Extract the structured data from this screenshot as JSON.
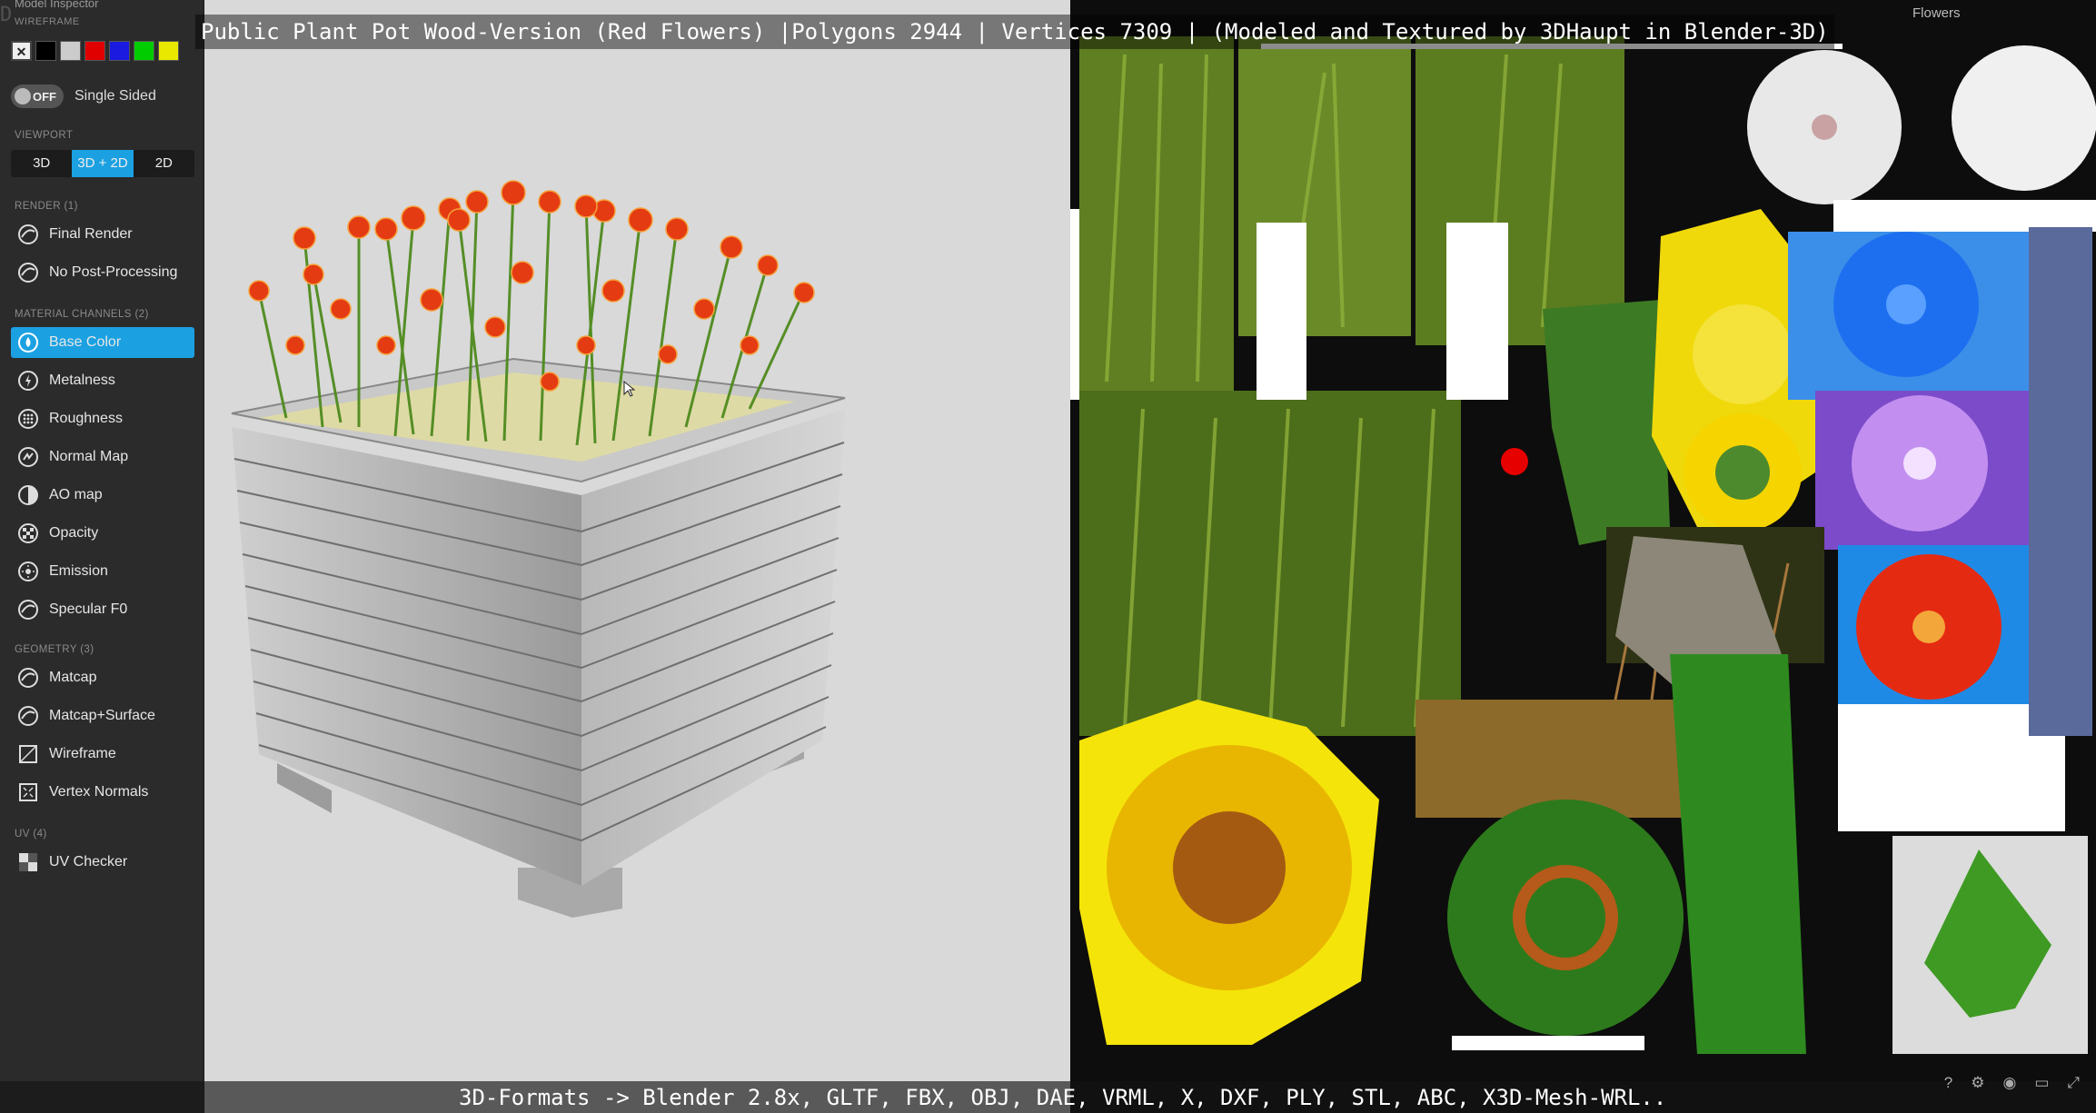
{
  "app": {
    "title_overlay": "Public Plant Pot Wood-Version (Red Flowers) |Polygons 2944 | Vertices 7309 | (Modeled and Textured by 3DHaupt in Blender-3D)",
    "formats_overlay": "3D-Formats -> Blender 2.8x, GLTF, FBX, OBJ, DAE, VRML, X, DXF, PLY, STL, ABC, X3D-Mesh-WRL..",
    "uv_panel_label": "Flowers"
  },
  "sidebar": {
    "header": "Model Inspector",
    "wireframe_label": "WIREFRAME",
    "swatches": [
      "#000000",
      "#cccccc",
      "#e00000",
      "#1a1ae0",
      "#00cc00",
      "#e8e800"
    ],
    "single_sided": {
      "state": "OFF",
      "label": "Single Sided"
    },
    "viewport_label": "VIEWPORT",
    "viewport_modes": [
      "3D",
      "3D + 2D",
      "2D"
    ],
    "viewport_active": "3D + 2D",
    "render_label": "RENDER (1)",
    "render_items": [
      "Final Render",
      "No Post-Processing"
    ],
    "material_label": "MATERIAL CHANNELS (2)",
    "material_items": [
      "Base Color",
      "Metalness",
      "Roughness",
      "Normal Map",
      "AO map",
      "Opacity",
      "Emission",
      "Specular F0"
    ],
    "material_active": "Base Color",
    "geometry_label": "GEOMETRY (3)",
    "geometry_items": [
      "Matcap",
      "Matcap+Surface",
      "Wireframe",
      "Vertex Normals"
    ],
    "uv_label": "UV (4)",
    "uv_items": [
      "UV Checker"
    ]
  },
  "colors": {
    "accent": "#1ba1e2",
    "sidebar_bg": "#2b2b2b",
    "viewport_bg": "#d9d9d9"
  }
}
